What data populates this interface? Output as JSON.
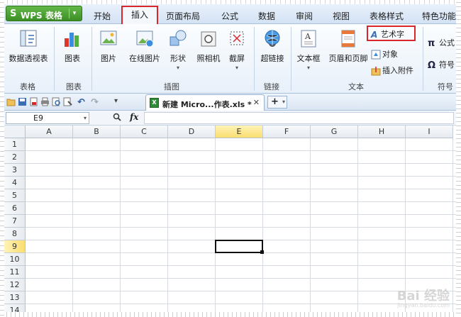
{
  "app": {
    "brand": "WPS 表格",
    "brand_logo": "S",
    "accent": "#3c8f25",
    "highlight": "#d8262a"
  },
  "menu": {
    "items": [
      "开始",
      "插入",
      "页面布局",
      "公式",
      "数据",
      "审阅",
      "视图",
      "表格样式",
      "特色功能"
    ],
    "active": "插入"
  },
  "ribbon": {
    "groups": {
      "table": "表格",
      "chart": "图表",
      "illustration": "插图",
      "link": "链接",
      "text": "文本",
      "symbol": "符号"
    },
    "buttons": {
      "pivot": "数据透视表",
      "chart": "图表",
      "picture": "图片",
      "online_picture": "在线图片",
      "shapes": "形状",
      "camera": "照相机",
      "screenshot": "截屏",
      "hyperlink": "超链接",
      "textbox": "文本框",
      "header_footer": "页眉和页脚",
      "wordart": "艺术字",
      "object": "对象",
      "attachment": "插入附件",
      "formula": "公式",
      "symbol": "符号"
    }
  },
  "tabs": {
    "doc_title": "新建 Micro...作表.xls *",
    "new_tab": "+"
  },
  "formula_bar": {
    "cell_ref": "E9",
    "fx": "fx",
    "zoom_icon": "🔍",
    "value": ""
  },
  "sheet": {
    "columns": [
      "A",
      "B",
      "C",
      "D",
      "E",
      "F",
      "G",
      "H",
      "I"
    ],
    "rows": [
      "1",
      "2",
      "3",
      "4",
      "5",
      "6",
      "7",
      "8",
      "9",
      "10",
      "11",
      "12",
      "13",
      "14"
    ],
    "selected": "E9"
  },
  "watermark": {
    "text": "Bai 经验",
    "sub": "jingyan.baidu.com"
  }
}
